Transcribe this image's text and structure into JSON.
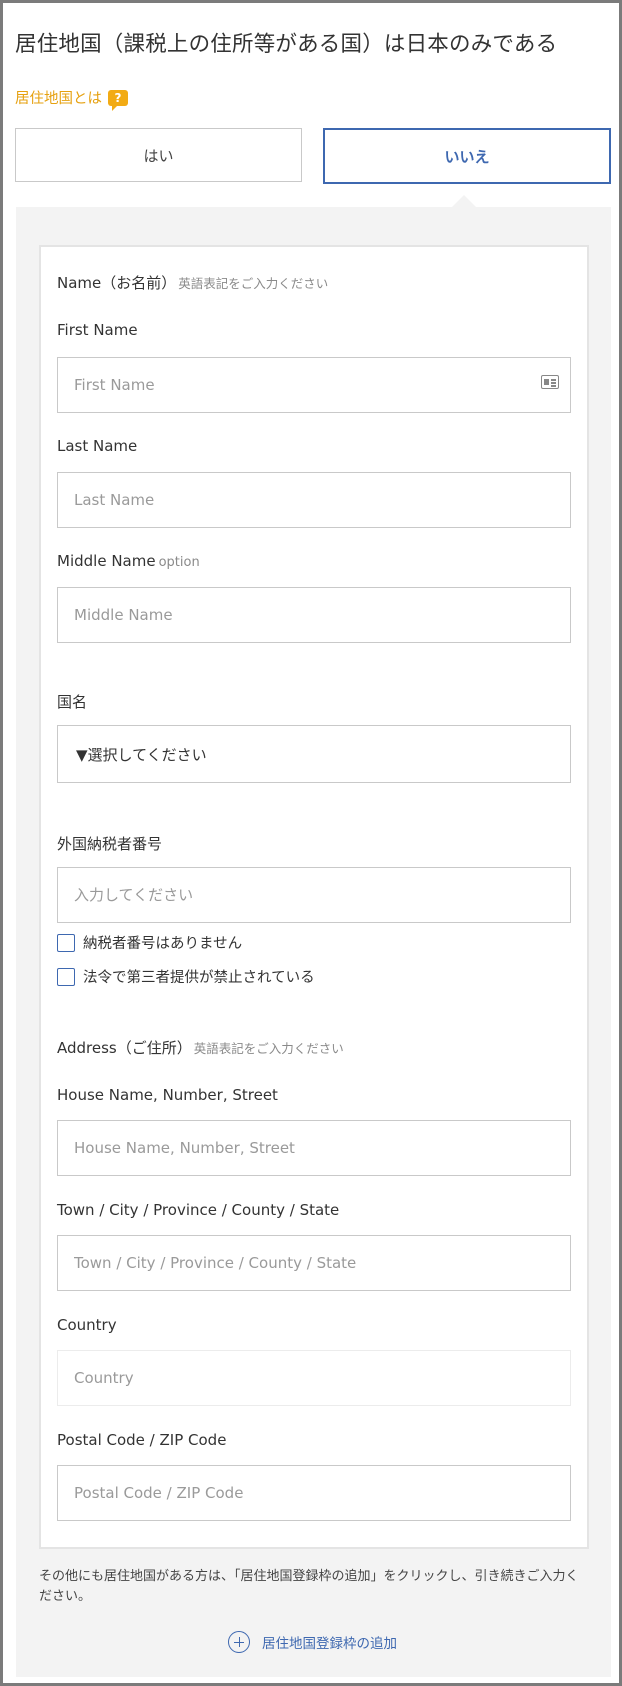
{
  "question": {
    "title": "居住地国（課税上の住所等がある国）は日本のみである",
    "help_link": "居住地国とは",
    "help_icon": "question-icon",
    "yes_label": "はい",
    "no_label": "いいえ",
    "selected": "いいえ"
  },
  "name_section": {
    "label": "Name（お名前）",
    "note": "英語表記をご入力ください",
    "first_name": {
      "label": "First Name",
      "placeholder": "First Name",
      "icon": "id-card-icon"
    },
    "last_name": {
      "label": "Last Name",
      "placeholder": "Last Name"
    },
    "middle_name": {
      "label": "Middle Name",
      "optional": "option",
      "placeholder": "Middle Name"
    }
  },
  "country": {
    "label": "国名",
    "selected": "▼選択してください"
  },
  "tax_id": {
    "label": "外国納税者番号",
    "placeholder": "入力してください",
    "checkbox_none": "納税者番号はありません",
    "checkbox_prohibited": "法令で第三者提供が禁止されている"
  },
  "address_section": {
    "label": "Address（ご住所）",
    "note": "英語表記をご入力ください",
    "street": {
      "label": "House Name, Number, Street",
      "placeholder": "House Name, Number, Street"
    },
    "town": {
      "label": "Town / City / Province / County / State",
      "placeholder": "Town / City / Province / County / State"
    },
    "country": {
      "label": "Country",
      "placeholder": "Country"
    },
    "postal": {
      "label": "Postal Code / ZIP Code",
      "placeholder": "Postal Code / ZIP Code"
    }
  },
  "footer": {
    "note": "その他にも居住地国がある方は、「居住地国登録枠の追加」をクリックし、引き続きご入力ください。",
    "add_label": "居住地国登録枠の追加",
    "add_icon": "plus-circle-icon"
  },
  "colors": {
    "accent_blue": "#3e68b0",
    "help_orange": "#e6a110",
    "panel_bg": "#f3f3f3"
  }
}
